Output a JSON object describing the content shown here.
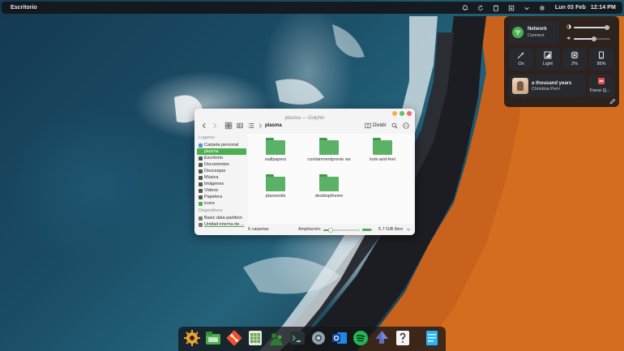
{
  "top_panel": {
    "title": "Escritorio",
    "tray_icons": [
      "bell-icon",
      "refresh-icon",
      "clipboard-icon",
      "download-icon",
      "chevron-down-icon",
      "power-icon"
    ],
    "date": "Lun 03 Feb",
    "time": "12:14 PM"
  },
  "control_center": {
    "network": {
      "title": "Network",
      "status": "Connect"
    },
    "brightness_level": 0.9,
    "volume_level": 0.55,
    "tiles": [
      {
        "label": "On",
        "icon": "wand-icon"
      },
      {
        "label": "Light",
        "icon": "theme-icon"
      },
      {
        "label": "2%",
        "icon": "cpu-icon"
      },
      {
        "label": "95%",
        "icon": "battery-phone-icon"
      }
    ],
    "media": {
      "song": "a thousand years",
      "artist": "Christina Perri"
    },
    "force_quit": "Force Q...",
    "colors": {
      "accent": "#4caf50",
      "panel": "#16181c"
    }
  },
  "dolphin": {
    "title": "plasma — Dolphin",
    "breadcrumb": "plasma",
    "split_label": "Dividir",
    "sidebar": {
      "places_header": "Lugares",
      "places": [
        {
          "label": "Carpeta personal",
          "icon": "home-icon"
        },
        {
          "label": "plasma",
          "icon": "folder-icon"
        },
        {
          "label": "Escritorio",
          "icon": "desktop-icon"
        },
        {
          "label": "Documentos",
          "icon": "document-icon"
        },
        {
          "label": "Descargas",
          "icon": "download-icon"
        },
        {
          "label": "Música",
          "icon": "music-icon"
        },
        {
          "label": "Imágenes",
          "icon": "image-icon"
        },
        {
          "label": "Vídeos",
          "icon": "video-icon"
        },
        {
          "label": "Papelera",
          "icon": "trash-icon"
        },
        {
          "label": "icons",
          "icon": "folder-icon"
        }
      ],
      "devices_header": "Dispositivos",
      "devices": [
        {
          "label": "Basic data partition",
          "icon": "drive-icon"
        },
        {
          "label": "Unidad interna de ...",
          "icon": "drive-icon"
        }
      ]
    },
    "folders": [
      {
        "name": "wallpapers"
      },
      {
        "name": "containmentprevie ws"
      },
      {
        "name": "look-and-feel"
      },
      {
        "name": "plasmoids"
      },
      {
        "name": "desktoptheme"
      }
    ],
    "status": {
      "count": "6 carpetas",
      "zoom_label": "Ampliación:",
      "zoom_level": 0.2,
      "free_space": "5.7 GiB libre",
      "used_fraction": 0.85
    }
  },
  "dock": {
    "apps": [
      "settings-kde-icon",
      "file-manager-icon",
      "git-icon",
      "office-icon",
      "fedora-icon",
      "terminal-icon",
      "system-settings-icon",
      "outlook-icon",
      "spotify-icon",
      "inkscape-icon",
      "help-icon",
      "notes-icon"
    ]
  }
}
